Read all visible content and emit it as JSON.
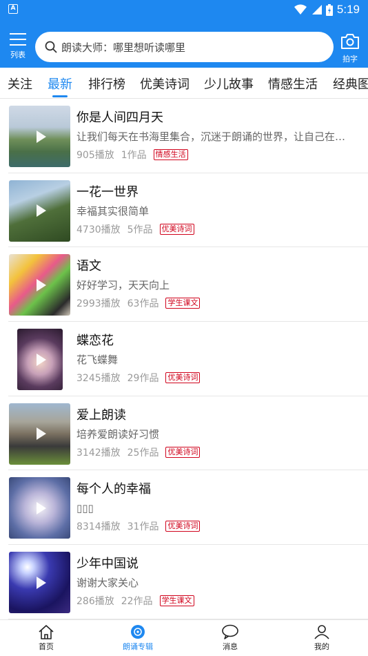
{
  "status_bar": {
    "time": "5:19",
    "app_icon": "A"
  },
  "header": {
    "menu_label": "列表",
    "search_placeholder": "朗读大师：哪里想听读哪里",
    "camera_label": "拍字"
  },
  "tabs": [
    {
      "label": "关注"
    },
    {
      "label": "最新"
    },
    {
      "label": "排行榜"
    },
    {
      "label": "优美诗词"
    },
    {
      "label": "少儿故事"
    },
    {
      "label": "情感生活"
    },
    {
      "label": "经典图"
    }
  ],
  "active_tab": "最新",
  "items": [
    {
      "title": "你是人间四月天",
      "desc": "让我们每天在书海里集合，沉迷于朗诵的世界，让自己在…",
      "plays": "905播放",
      "works": "1作品",
      "tag": "情感生活"
    },
    {
      "title": "一花一世界",
      "desc": "幸福其实很简单",
      "plays": "4730播放",
      "works": "5作品",
      "tag": "优美诗词"
    },
    {
      "title": "语文",
      "desc": "好好学习，天天向上",
      "plays": "2993播放",
      "works": "63作品",
      "tag": "学生课文"
    },
    {
      "title": "蝶恋花",
      "desc": "花飞蝶舞",
      "plays": "3245播放",
      "works": "29作品",
      "tag": "优美诗词"
    },
    {
      "title": "爱上朗读",
      "desc": "培养爱朗读好习惯",
      "plays": "3142播放",
      "works": "25作品",
      "tag": "优美诗词"
    },
    {
      "title": "每个人的幸福",
      "desc": "▯▯▯",
      "plays": "8314播放",
      "works": "31作品",
      "tag": "优美诗词"
    },
    {
      "title": "少年中国说",
      "desc": "谢谢大家关心",
      "plays": "286播放",
      "works": "22作品",
      "tag": "学生课文"
    }
  ],
  "bottom_nav": [
    {
      "label": "首页",
      "icon": "home-icon"
    },
    {
      "label": "朗诵专辑",
      "icon": "album-icon"
    },
    {
      "label": "消息",
      "icon": "message-icon"
    },
    {
      "label": "我的",
      "icon": "profile-icon"
    }
  ],
  "colors": {
    "brand_blue": "#1e88f0",
    "tag_red": "#d0021b"
  }
}
